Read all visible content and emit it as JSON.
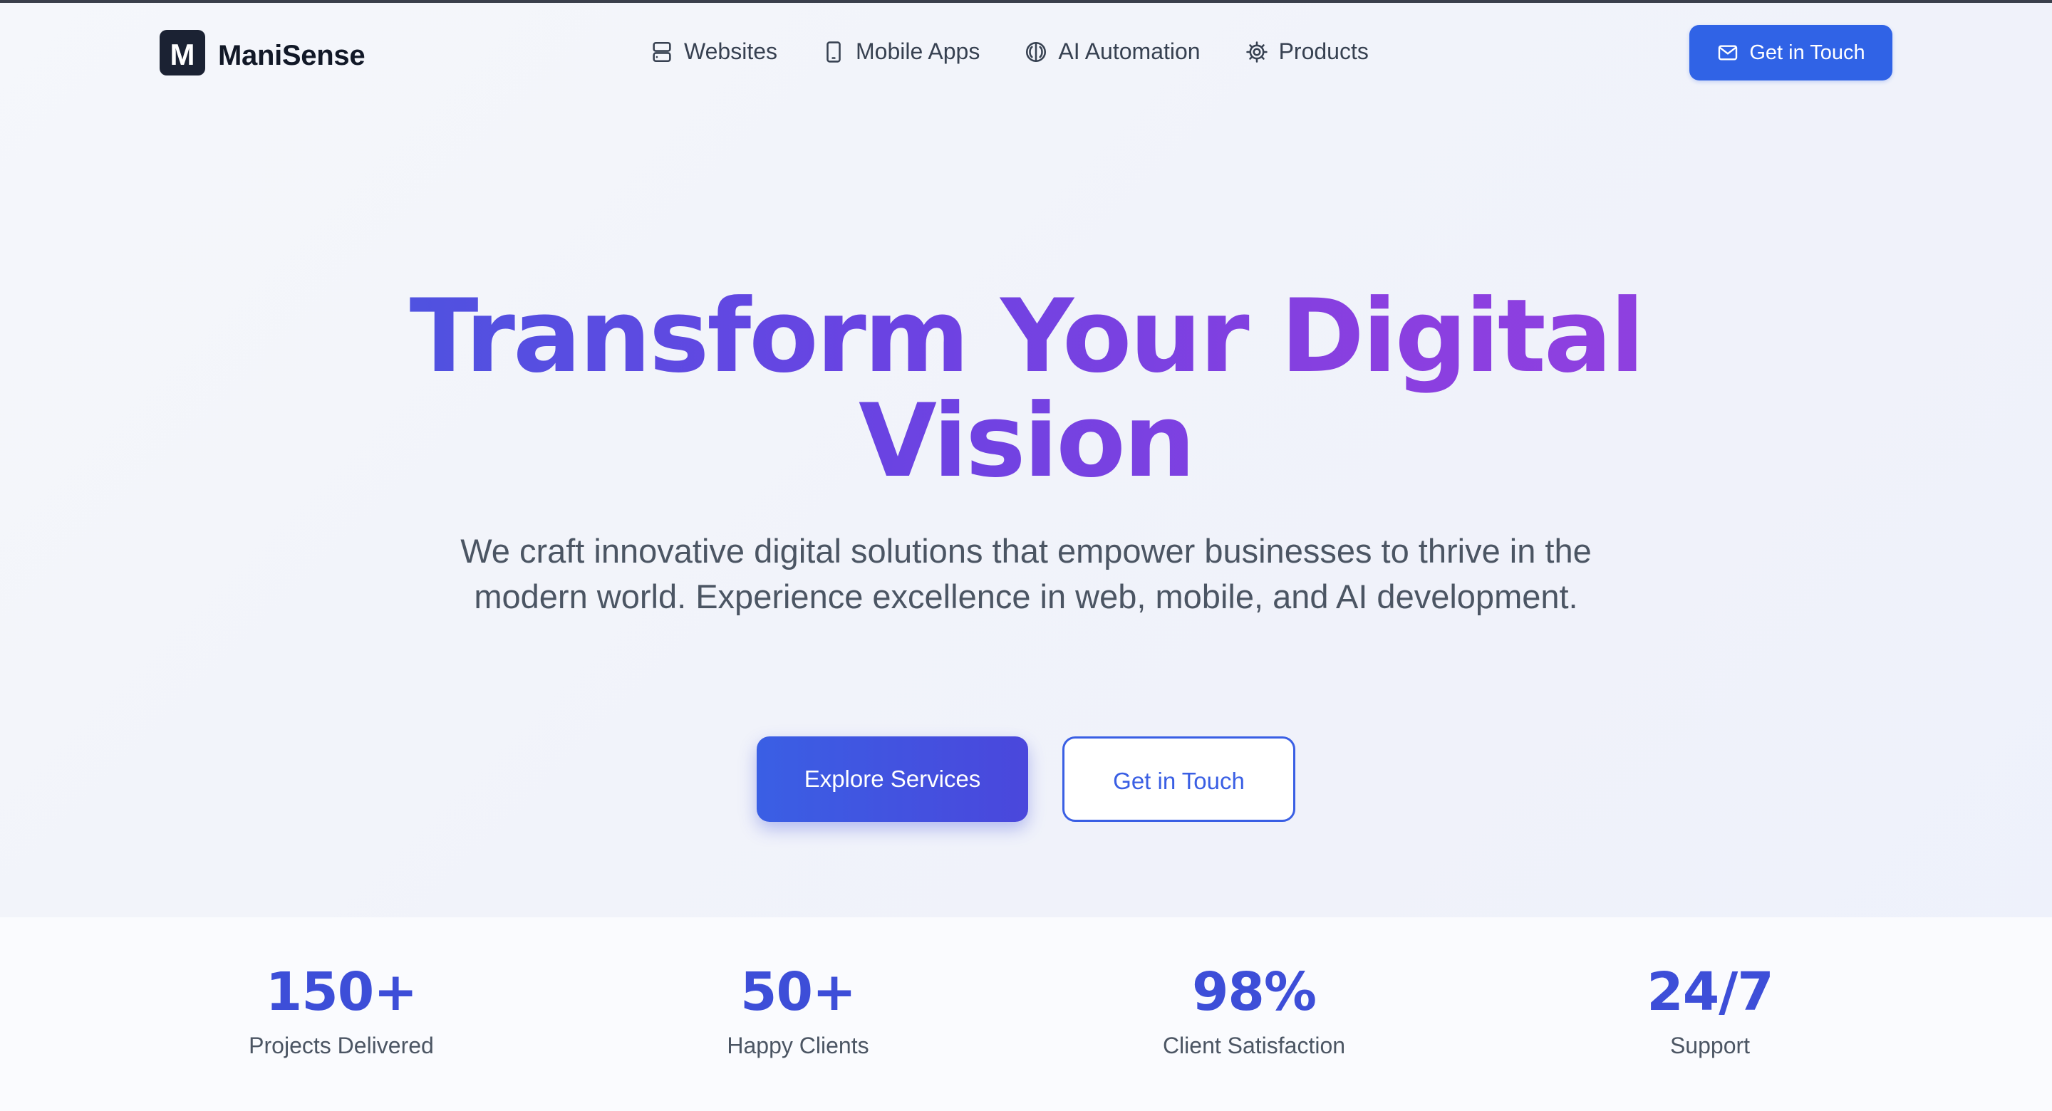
{
  "brand": {
    "mark": "M",
    "name": "ManiSense"
  },
  "nav": {
    "items": [
      {
        "label": "Websites",
        "icon": "server-icon"
      },
      {
        "label": "Mobile Apps",
        "icon": "smartphone-icon"
      },
      {
        "label": "AI Automation",
        "icon": "brain-icon"
      },
      {
        "label": "Products",
        "icon": "gear-icon"
      }
    ],
    "cta_label": "Get in Touch",
    "cta_icon": "mail-icon"
  },
  "hero": {
    "title_line1": "Transform Your Digital",
    "title_line2": "Vision",
    "subtitle": "We craft innovative digital solutions that empower businesses to thrive in the modern world. Experience excellence in web, mobile, and AI development.",
    "primary_button": "Explore Services",
    "secondary_button": "Get in Touch"
  },
  "stats": [
    {
      "value": "150+",
      "label": "Projects Delivered"
    },
    {
      "value": "50+",
      "label": "Happy Clients"
    },
    {
      "value": "98%",
      "label": "Client Satisfaction"
    },
    {
      "value": "24/7",
      "label": "Support"
    }
  ],
  "colors": {
    "accent": "#3063e6",
    "gradient_start": "#4a55e0",
    "gradient_end": "#9040df",
    "stat_value": "#3d4ed8"
  }
}
